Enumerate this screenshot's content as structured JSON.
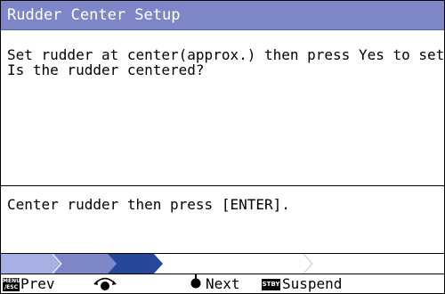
{
  "dialog": {
    "title": "Rudder Center Setup",
    "message_line1": "Set rudder at center(approx.) then press Yes to set.",
    "message_line2": "Is the rudder centered?",
    "instruction": "Center rudder then press [ENTER]."
  },
  "progress": {
    "steps_total": 4,
    "completed_steps": 1,
    "current_step": 2
  },
  "footer": {
    "prev_key_label": "MENU/ESC",
    "prev_label": "Prev",
    "next_label": "Next",
    "stby_key_label": "STBY",
    "suspend_label": "Suspend"
  },
  "icons": {
    "menu_key": "menu-esc-key-icon",
    "course_knob": "course-knob-icon",
    "knob_push": "knob-push-icon",
    "stby_key": "stby-key-icon"
  },
  "colors": {
    "title_bar": "#7d86c6",
    "progress_done": "#a7b0e2",
    "progress_current": "#25489a"
  }
}
